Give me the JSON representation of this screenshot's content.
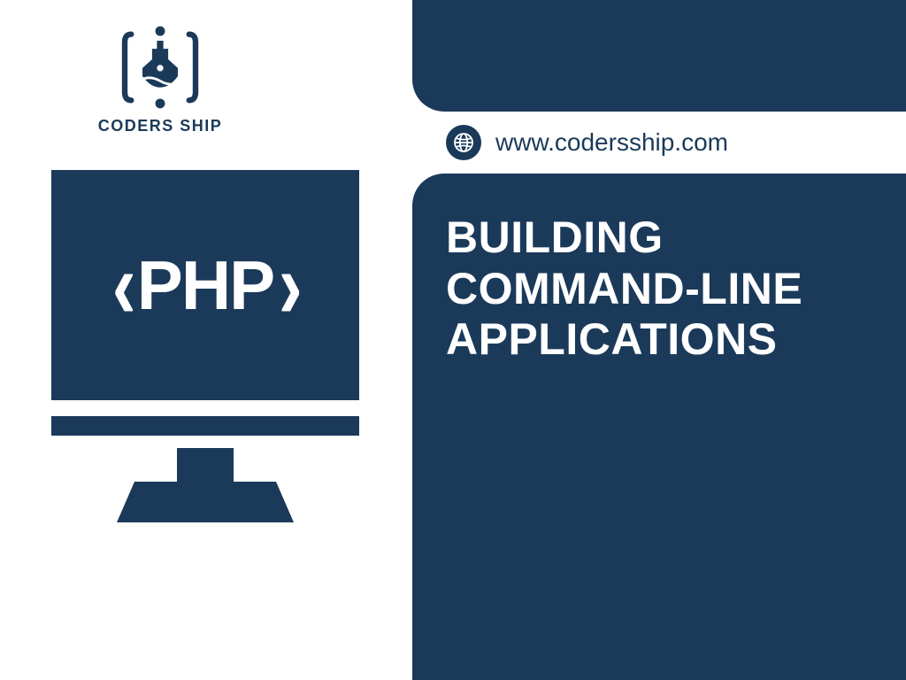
{
  "colors": {
    "brand": "#1b3a5a",
    "text_on_dark": "#ffffff"
  },
  "logo": {
    "label": "CODERS SHIP",
    "icon_name": "ship-in-braces"
  },
  "website": {
    "url": "www.codersship.com",
    "icon_name": "globe-icon"
  },
  "illustration": {
    "tag_left": "‹",
    "tag_text": "PHP",
    "tag_right": "›",
    "device": "desktop-monitor"
  },
  "headline": {
    "line1": "BUILDING",
    "line2": "COMMAND-LINE",
    "line3": "APPLICATIONS"
  }
}
